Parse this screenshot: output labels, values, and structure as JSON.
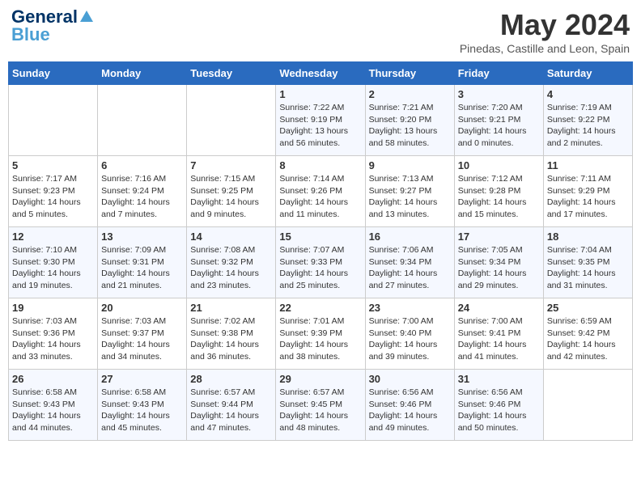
{
  "header": {
    "logo_general": "General",
    "logo_blue": "Blue",
    "month_title": "May 2024",
    "location": "Pinedas, Castille and Leon, Spain"
  },
  "days_of_week": [
    "Sunday",
    "Monday",
    "Tuesday",
    "Wednesday",
    "Thursday",
    "Friday",
    "Saturday"
  ],
  "weeks": [
    [
      {
        "day": "",
        "sunrise": "",
        "sunset": "",
        "daylight": ""
      },
      {
        "day": "",
        "sunrise": "",
        "sunset": "",
        "daylight": ""
      },
      {
        "day": "",
        "sunrise": "",
        "sunset": "",
        "daylight": ""
      },
      {
        "day": "1",
        "sunrise": "Sunrise: 7:22 AM",
        "sunset": "Sunset: 9:19 PM",
        "daylight": "Daylight: 13 hours and 56 minutes."
      },
      {
        "day": "2",
        "sunrise": "Sunrise: 7:21 AM",
        "sunset": "Sunset: 9:20 PM",
        "daylight": "Daylight: 13 hours and 58 minutes."
      },
      {
        "day": "3",
        "sunrise": "Sunrise: 7:20 AM",
        "sunset": "Sunset: 9:21 PM",
        "daylight": "Daylight: 14 hours and 0 minutes."
      },
      {
        "day": "4",
        "sunrise": "Sunrise: 7:19 AM",
        "sunset": "Sunset: 9:22 PM",
        "daylight": "Daylight: 14 hours and 2 minutes."
      }
    ],
    [
      {
        "day": "5",
        "sunrise": "Sunrise: 7:17 AM",
        "sunset": "Sunset: 9:23 PM",
        "daylight": "Daylight: 14 hours and 5 minutes."
      },
      {
        "day": "6",
        "sunrise": "Sunrise: 7:16 AM",
        "sunset": "Sunset: 9:24 PM",
        "daylight": "Daylight: 14 hours and 7 minutes."
      },
      {
        "day": "7",
        "sunrise": "Sunrise: 7:15 AM",
        "sunset": "Sunset: 9:25 PM",
        "daylight": "Daylight: 14 hours and 9 minutes."
      },
      {
        "day": "8",
        "sunrise": "Sunrise: 7:14 AM",
        "sunset": "Sunset: 9:26 PM",
        "daylight": "Daylight: 14 hours and 11 minutes."
      },
      {
        "day": "9",
        "sunrise": "Sunrise: 7:13 AM",
        "sunset": "Sunset: 9:27 PM",
        "daylight": "Daylight: 14 hours and 13 minutes."
      },
      {
        "day": "10",
        "sunrise": "Sunrise: 7:12 AM",
        "sunset": "Sunset: 9:28 PM",
        "daylight": "Daylight: 14 hours and 15 minutes."
      },
      {
        "day": "11",
        "sunrise": "Sunrise: 7:11 AM",
        "sunset": "Sunset: 9:29 PM",
        "daylight": "Daylight: 14 hours and 17 minutes."
      }
    ],
    [
      {
        "day": "12",
        "sunrise": "Sunrise: 7:10 AM",
        "sunset": "Sunset: 9:30 PM",
        "daylight": "Daylight: 14 hours and 19 minutes."
      },
      {
        "day": "13",
        "sunrise": "Sunrise: 7:09 AM",
        "sunset": "Sunset: 9:31 PM",
        "daylight": "Daylight: 14 hours and 21 minutes."
      },
      {
        "day": "14",
        "sunrise": "Sunrise: 7:08 AM",
        "sunset": "Sunset: 9:32 PM",
        "daylight": "Daylight: 14 hours and 23 minutes."
      },
      {
        "day": "15",
        "sunrise": "Sunrise: 7:07 AM",
        "sunset": "Sunset: 9:33 PM",
        "daylight": "Daylight: 14 hours and 25 minutes."
      },
      {
        "day": "16",
        "sunrise": "Sunrise: 7:06 AM",
        "sunset": "Sunset: 9:34 PM",
        "daylight": "Daylight: 14 hours and 27 minutes."
      },
      {
        "day": "17",
        "sunrise": "Sunrise: 7:05 AM",
        "sunset": "Sunset: 9:34 PM",
        "daylight": "Daylight: 14 hours and 29 minutes."
      },
      {
        "day": "18",
        "sunrise": "Sunrise: 7:04 AM",
        "sunset": "Sunset: 9:35 PM",
        "daylight": "Daylight: 14 hours and 31 minutes."
      }
    ],
    [
      {
        "day": "19",
        "sunrise": "Sunrise: 7:03 AM",
        "sunset": "Sunset: 9:36 PM",
        "daylight": "Daylight: 14 hours and 33 minutes."
      },
      {
        "day": "20",
        "sunrise": "Sunrise: 7:03 AM",
        "sunset": "Sunset: 9:37 PM",
        "daylight": "Daylight: 14 hours and 34 minutes."
      },
      {
        "day": "21",
        "sunrise": "Sunrise: 7:02 AM",
        "sunset": "Sunset: 9:38 PM",
        "daylight": "Daylight: 14 hours and 36 minutes."
      },
      {
        "day": "22",
        "sunrise": "Sunrise: 7:01 AM",
        "sunset": "Sunset: 9:39 PM",
        "daylight": "Daylight: 14 hours and 38 minutes."
      },
      {
        "day": "23",
        "sunrise": "Sunrise: 7:00 AM",
        "sunset": "Sunset: 9:40 PM",
        "daylight": "Daylight: 14 hours and 39 minutes."
      },
      {
        "day": "24",
        "sunrise": "Sunrise: 7:00 AM",
        "sunset": "Sunset: 9:41 PM",
        "daylight": "Daylight: 14 hours and 41 minutes."
      },
      {
        "day": "25",
        "sunrise": "Sunrise: 6:59 AM",
        "sunset": "Sunset: 9:42 PM",
        "daylight": "Daylight: 14 hours and 42 minutes."
      }
    ],
    [
      {
        "day": "26",
        "sunrise": "Sunrise: 6:58 AM",
        "sunset": "Sunset: 9:43 PM",
        "daylight": "Daylight: 14 hours and 44 minutes."
      },
      {
        "day": "27",
        "sunrise": "Sunrise: 6:58 AM",
        "sunset": "Sunset: 9:43 PM",
        "daylight": "Daylight: 14 hours and 45 minutes."
      },
      {
        "day": "28",
        "sunrise": "Sunrise: 6:57 AM",
        "sunset": "Sunset: 9:44 PM",
        "daylight": "Daylight: 14 hours and 47 minutes."
      },
      {
        "day": "29",
        "sunrise": "Sunrise: 6:57 AM",
        "sunset": "Sunset: 9:45 PM",
        "daylight": "Daylight: 14 hours and 48 minutes."
      },
      {
        "day": "30",
        "sunrise": "Sunrise: 6:56 AM",
        "sunset": "Sunset: 9:46 PM",
        "daylight": "Daylight: 14 hours and 49 minutes."
      },
      {
        "day": "31",
        "sunrise": "Sunrise: 6:56 AM",
        "sunset": "Sunset: 9:46 PM",
        "daylight": "Daylight: 14 hours and 50 minutes."
      },
      {
        "day": "",
        "sunrise": "",
        "sunset": "",
        "daylight": ""
      }
    ]
  ]
}
